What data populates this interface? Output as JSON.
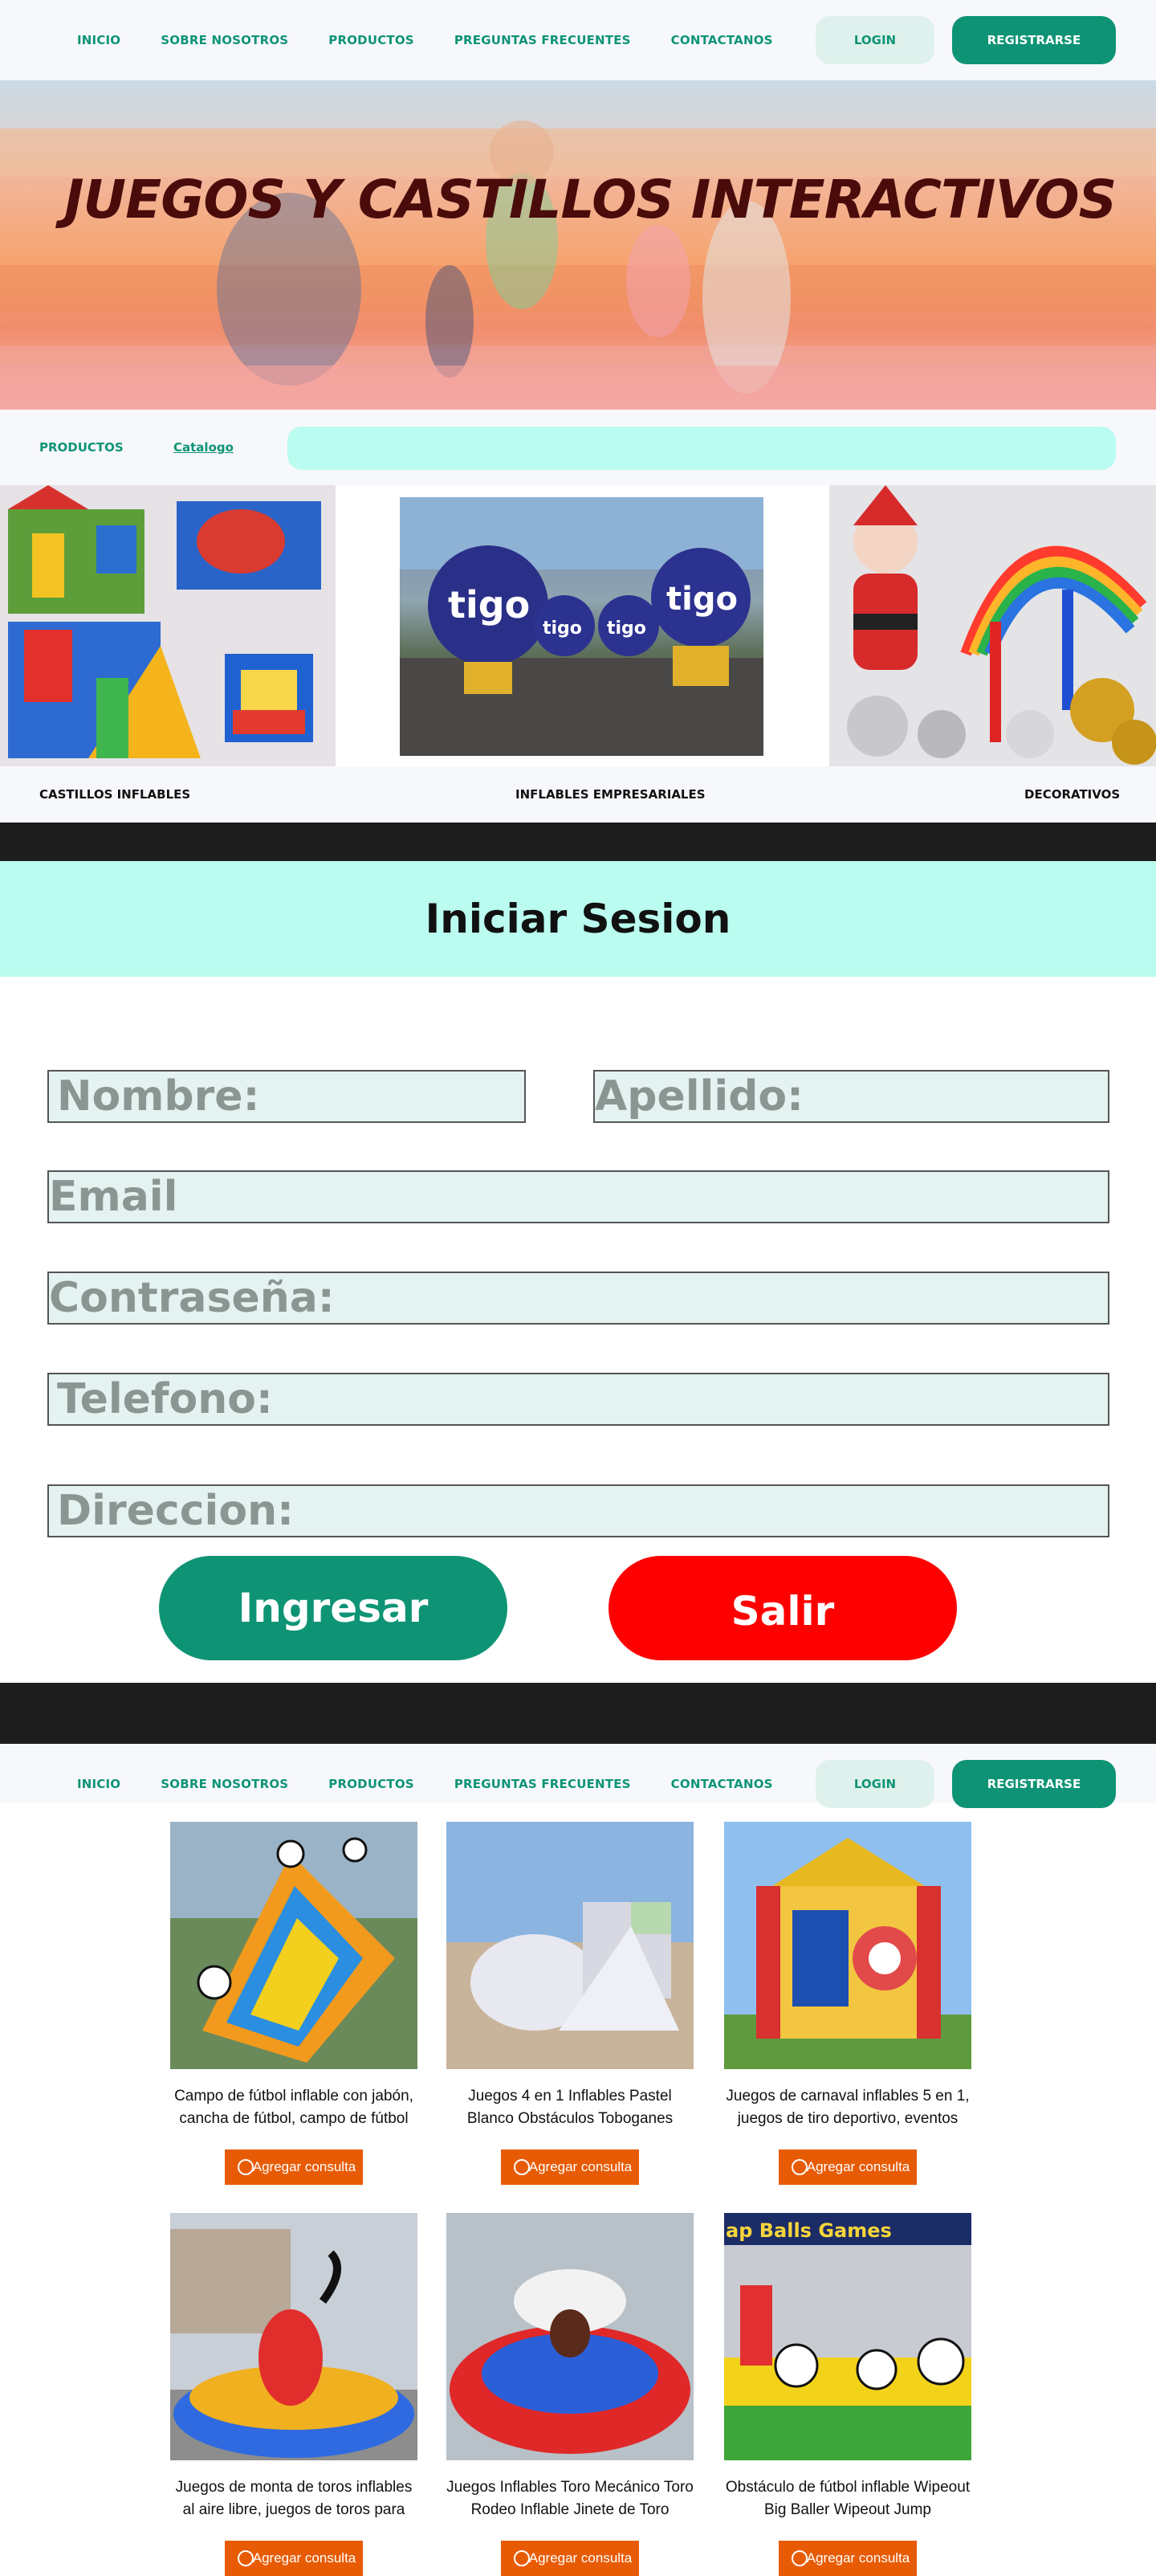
{
  "nav": {
    "links": [
      "INICIO",
      "SOBRE NOSOTROS",
      "PRODUCTOS",
      "PREGUNTAS FRECUENTES",
      "CONTACTANOS"
    ],
    "login": "LOGIN",
    "register": "REGISTRARSE"
  },
  "hero": {
    "title": "JUEGOS  Y CASTILLOS INTERACTIVOS"
  },
  "subnav": {
    "productos": "PRODUCTOS",
    "catalogo": "Catalogo",
    "search_value": ""
  },
  "categories": [
    "CASTILLOS INFLABLES",
    "INFLABLES EMPRESARIALES",
    "DECORATIVOS"
  ],
  "login_form": {
    "title": "Iniciar Sesion",
    "nombre": "Nombre:",
    "apellido": "Apellido:",
    "email": "Email",
    "password": "Contraseña:",
    "telefono": "Telefono:",
    "direccion": "Direccion:",
    "ingresar": "Ingresar",
    "salir": "Salir"
  },
  "products": [
    {
      "desc": "Campo de fútbol inflable con jabón, cancha de fútbol, campo de fútbol",
      "button": "Agregar consulta"
    },
    {
      "desc": "Juegos 4 en 1 Inflables Pastel Blanco Obstáculos Toboganes",
      "button": "Agregar consulta"
    },
    {
      "desc": "Juegos de carnaval inflables 5 en 1, juegos de tiro deportivo, eventos",
      "button": "Agregar consulta"
    },
    {
      "desc": "Juegos de monta de toros inflables al aire libre, juegos de toros para",
      "button": "Agregar consulta"
    },
    {
      "desc": "Juegos Inflables Toro Mecánico Toro Rodeo Inflable Jinete de Toro",
      "button": "Agregar consulta"
    },
    {
      "desc": "Obstáculo de fútbol inflable Wipeout Big Baller Wipeout Jump",
      "button": "Agregar consulta"
    }
  ],
  "image_texts": {
    "tigo": "tigo",
    "balls_games": "ap Balls Games"
  },
  "colors": {
    "brand": "#0e9475",
    "accent_mint": "#bafcef",
    "danger": "#ff0000",
    "product_button": "#e85b05",
    "hero_title": "#4a0b0b"
  }
}
